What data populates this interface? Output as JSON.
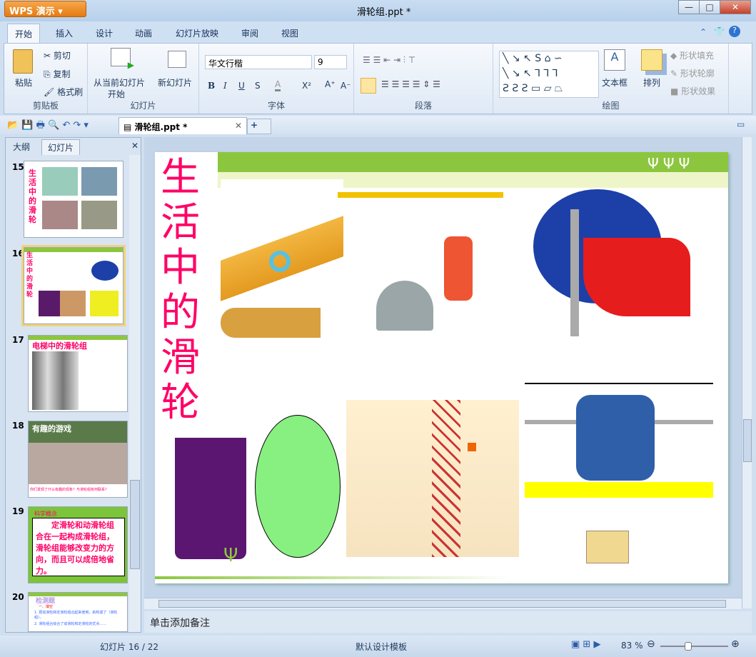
{
  "app": {
    "name": "WPS 演示",
    "title": "滑轮组.ppt *"
  },
  "window": {
    "minimize": "—",
    "maximize": "□",
    "close": "✕"
  },
  "menu_tabs": [
    "开始",
    "插入",
    "设计",
    "动画",
    "幻灯片放映",
    "审阅",
    "视图"
  ],
  "ribbon": {
    "clipboard": {
      "paste": "粘贴",
      "cut": "剪切",
      "copy": "复制",
      "format_painter": "格式刷",
      "label": "剪贴板"
    },
    "slides": {
      "from_current": "从当前幻灯片",
      "start": "开始",
      "new_slide": "新幻灯片",
      "label": "幻灯片"
    },
    "font": {
      "name": "华文行楷",
      "size": "9",
      "bold": "B",
      "italic": "I",
      "underline": "U",
      "shadow": "S",
      "color": "A",
      "superscript": "X²",
      "grow": "A⁺",
      "shrink": "A⁻",
      "label": "字体"
    },
    "paragraph": {
      "label": "段落"
    },
    "drawing": {
      "textbox": "文本框",
      "arrange": "排列",
      "shape_fill": "形状填充",
      "shape_outline": "形状轮廓",
      "shape_effect": "形状效果",
      "label": "绘图"
    }
  },
  "doc_tab": {
    "name": "滑轮组.ppt *",
    "new": "+"
  },
  "panel": {
    "tab_outline": "大纲",
    "tab_slides": "幻灯片",
    "close": "✕",
    "thumbs": [
      {
        "num": "15",
        "title": "生活中的滑轮"
      },
      {
        "num": "16",
        "title": "生活中的滑轮"
      },
      {
        "num": "17",
        "title": "电梯中的滑轮组"
      },
      {
        "num": "18",
        "title": "有趣的游戏",
        "caption": "你们发现了什么有趣的现象？与滑轮组有何联系？"
      },
      {
        "num": "19",
        "title": "科学概念",
        "body": "定滑轮和动滑轮组合在一起构成滑轮组，滑轮组能够改变力的方向，而且可以成倍地省力。"
      },
      {
        "num": "20",
        "title": "检测题",
        "line1": "一、填空",
        "line2": "1. 把动滑轮和定滑轮组合起来使用，就构成了（滑轮组）。",
        "line3": "2. 滑轮组合综合了动滑轮和定滑轮的优点……"
      }
    ]
  },
  "slide": {
    "title": "生活中的滑轮"
  },
  "notes": {
    "placeholder": "单击添加备注"
  },
  "status": {
    "slide_pos": "幻灯片 16 / 22",
    "template": "默认设计模板",
    "zoom": "83 %"
  },
  "colors": {
    "title": "#ff0066",
    "accent_green": "#8cc63f"
  }
}
